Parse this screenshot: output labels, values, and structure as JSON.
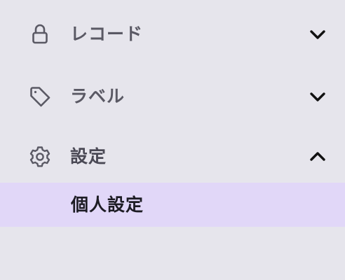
{
  "sidebar": {
    "items": [
      {
        "label": "レコード",
        "icon": "lock-icon",
        "expanded": false
      },
      {
        "label": "ラベル",
        "icon": "tag-icon",
        "expanded": false
      },
      {
        "label": "設定",
        "icon": "gear-icon",
        "expanded": true,
        "children": [
          {
            "label": "個人設定",
            "selected": true
          }
        ]
      }
    ]
  },
  "colors": {
    "background": "#e6e5ec",
    "selected_background": "#e1d7f8",
    "label_text": "#5a5964",
    "selected_text": "#1d1c24",
    "chevron": "#111111"
  }
}
